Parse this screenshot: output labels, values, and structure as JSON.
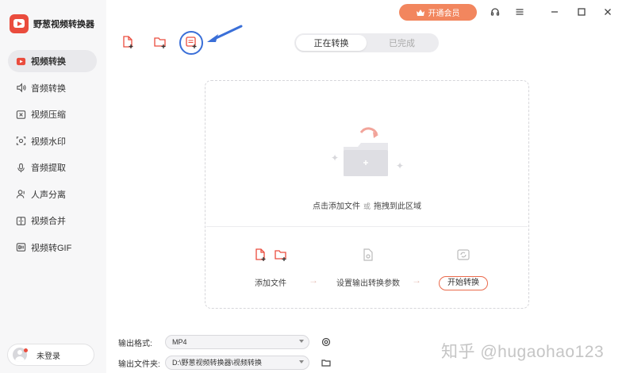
{
  "app": {
    "name": "野葱视频转换器"
  },
  "sidebar": {
    "items": [
      {
        "label": "视频转换",
        "icon": "video-convert-icon",
        "active": true
      },
      {
        "label": "音频转换",
        "icon": "audio-convert-icon"
      },
      {
        "label": "视频压缩",
        "icon": "video-compress-icon"
      },
      {
        "label": "视频水印",
        "icon": "video-watermark-icon"
      },
      {
        "label": "音频提取",
        "icon": "audio-extract-icon"
      },
      {
        "label": "人声分离",
        "icon": "vocal-separate-icon"
      },
      {
        "label": "视频合并",
        "icon": "video-merge-icon"
      },
      {
        "label": "视频转GIF",
        "icon": "video-to-gif-icon"
      }
    ],
    "login_label": "未登录"
  },
  "topbar": {
    "vip_label": "开通会员",
    "icons": [
      "headset-icon",
      "menu-icon",
      "minimize-icon",
      "maximize-icon",
      "close-icon"
    ]
  },
  "toolbar": {
    "icons": [
      "add-file-icon",
      "add-folder-icon",
      "add-dvd-icon"
    ]
  },
  "tabs": [
    {
      "label": "正在转换",
      "active": true
    },
    {
      "label": "已完成",
      "active": false
    }
  ],
  "dropzone": {
    "hint_left": "点击添加文件",
    "hint_or": "或",
    "hint_right": "拖拽到此区域",
    "steps": [
      {
        "label": "添加文件"
      },
      {
        "label": "设置输出转换参数"
      },
      {
        "label": "开始转换"
      }
    ]
  },
  "output": {
    "format_label": "输出格式:",
    "format_value": "MP4",
    "folder_label": "输出文件夹:",
    "folder_value": "D:\\野葱视频转换器\\视频转换"
  },
  "watermark": "知乎 @hugaohao123",
  "colors": {
    "accent": "#ea4c3d",
    "vip": "#f2865e",
    "annotation": "#3a6fd8"
  }
}
